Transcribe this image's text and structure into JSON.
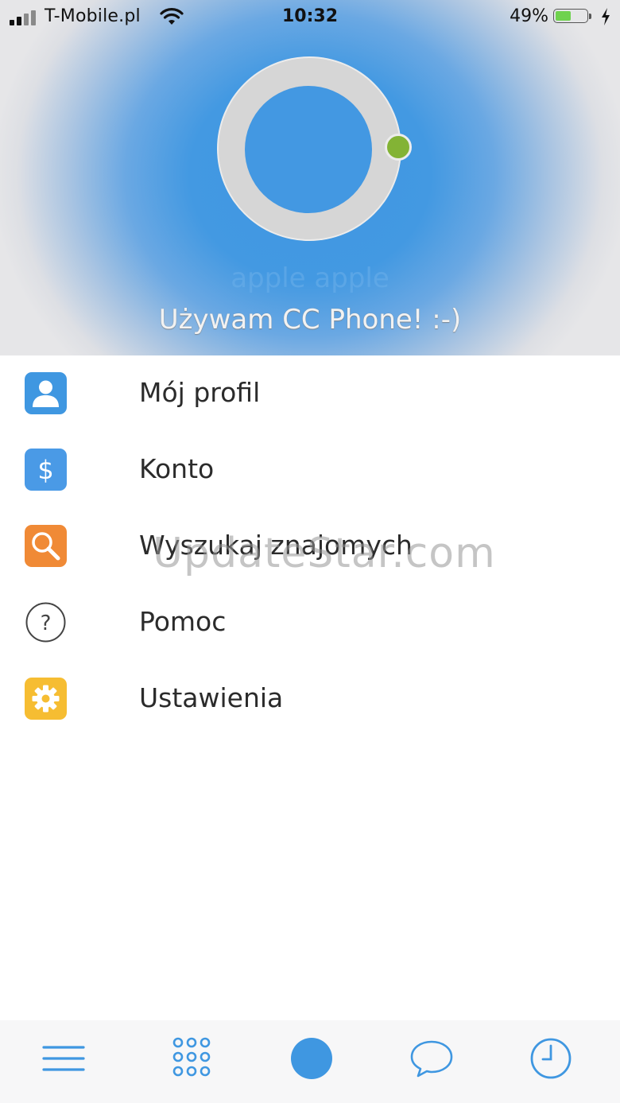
{
  "status_bar": {
    "carrier": "T-Mobile.pl",
    "time": "10:32",
    "battery_percent": "49%",
    "battery_level": 0.49
  },
  "profile": {
    "name": "apple apple",
    "status_message": "Używam CC Phone! :-)",
    "presence_color": "#83b335"
  },
  "menu": {
    "items": [
      {
        "label": "Mój profil",
        "icon": "user-icon",
        "color": "#3f97e1"
      },
      {
        "label": "Konto",
        "icon": "dollar-icon",
        "color": "#4a9ae6"
      },
      {
        "label": "Wyszukaj znajomych",
        "icon": "search-icon",
        "color": "#f08a36"
      },
      {
        "label": "Pomoc",
        "icon": "help-icon",
        "color": "#444444"
      },
      {
        "label": "Ustawienia",
        "icon": "gear-icon",
        "color": "#f6bd32"
      }
    ]
  },
  "watermark": "UpdateStar.com",
  "tab_bar": {
    "accent": "#3f97e1",
    "tabs": [
      "menu-icon",
      "dialpad-icon",
      "status-icon",
      "chat-icon",
      "history-icon"
    ]
  }
}
